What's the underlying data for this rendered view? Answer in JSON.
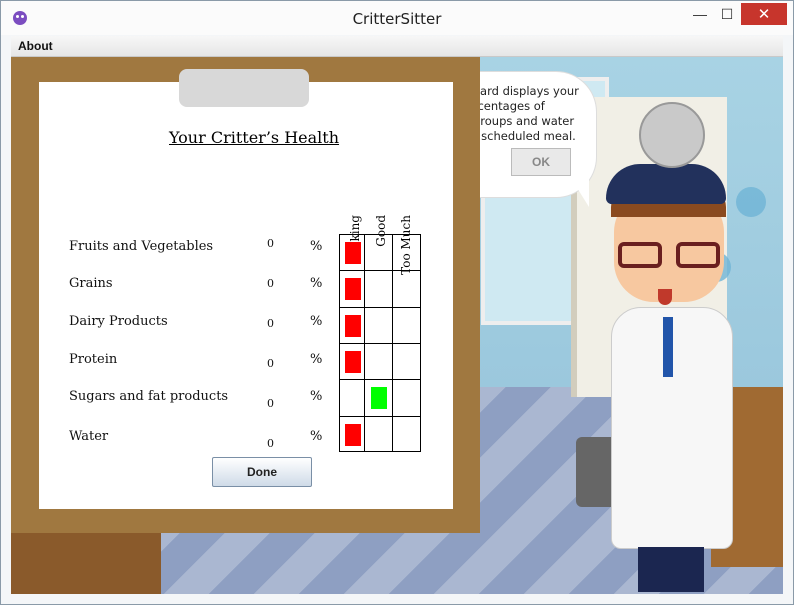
{
  "window": {
    "title": "CritterSitter",
    "minimize": "—",
    "maximize": "☐",
    "close": "✕"
  },
  "menu": {
    "about": "About"
  },
  "bubble": {
    "lines": [
      "oard displays your",
      "rcentages of",
      "groups and water",
      "t scheduled meal."
    ],
    "ok_label": "OK"
  },
  "health": {
    "title": "Your Critter’s Health",
    "columns": [
      "Lacking",
      "Good",
      "Too Much"
    ],
    "rows": [
      {
        "label": "Fruits and Vegetables",
        "value": "0",
        "unit": "%",
        "status": "Lacking",
        "color": "#ff0000"
      },
      {
        "label": "Grains",
        "value": "0",
        "unit": "%",
        "status": "Lacking",
        "color": "#ff0000"
      },
      {
        "label": "Dairy Products",
        "value": "0",
        "unit": "%",
        "status": "Lacking",
        "color": "#ff0000"
      },
      {
        "label": "Protein",
        "value": "0",
        "unit": "%",
        "status": "Lacking",
        "color": "#ff0000"
      },
      {
        "label": "Sugars and fat products",
        "value": "0",
        "unit": "%",
        "status": "Good",
        "color": "#00ff00"
      },
      {
        "label": "Water",
        "value": "0",
        "unit": "%",
        "status": "Lacking",
        "color": "#ff0000"
      }
    ],
    "done_label": "Done"
  }
}
